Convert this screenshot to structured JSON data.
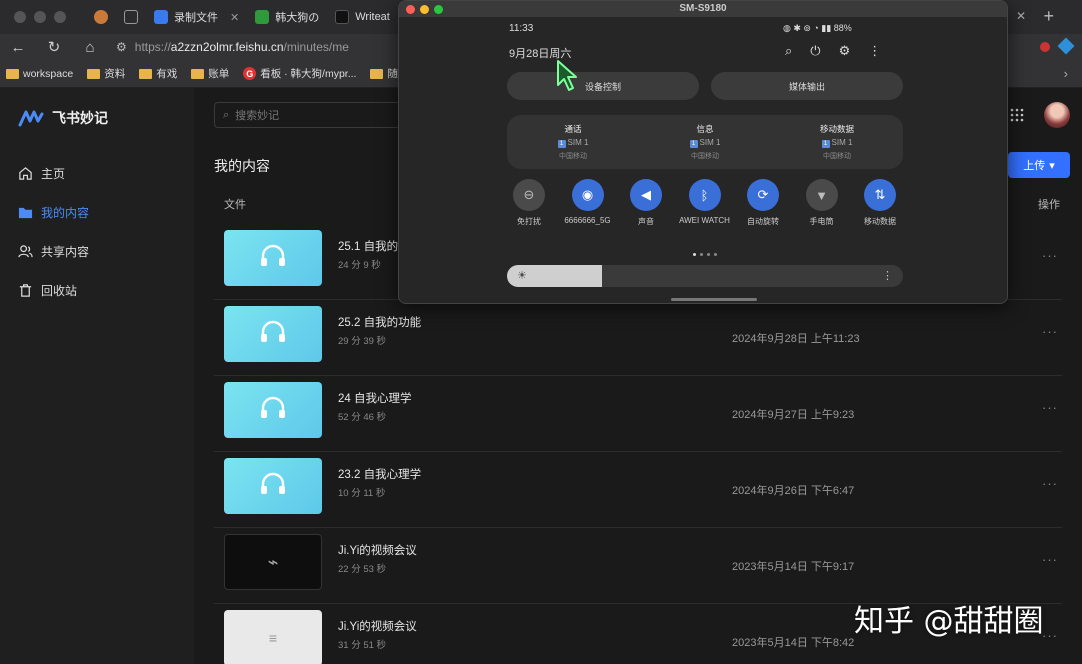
{
  "browser": {
    "tabs": [
      {
        "label": "",
        "color": "#c97a3a"
      },
      {
        "label": "",
        "color": "#555"
      },
      {
        "label": "录制文件",
        "color": "#3a7af0"
      },
      {
        "label": "韩大狗の",
        "color": "#2f9a3a"
      },
      {
        "label": "Writeat",
        "color": "#111"
      }
    ],
    "url_prefix": "https://",
    "url_host": "a2zzn2olmr.feishu.cn",
    "url_path": "/minutes/me",
    "bookmarks": [
      {
        "label": "workspace",
        "type": "folder"
      },
      {
        "label": "资料",
        "type": "folder"
      },
      {
        "label": "有戏",
        "type": "folder"
      },
      {
        "label": "账单",
        "type": "folder"
      },
      {
        "label": "看板 · 韩大狗/mypr...",
        "type": "g"
      },
      {
        "label": "随身",
        "type": "folder"
      }
    ]
  },
  "app": {
    "name": "飞书妙记",
    "nav": [
      {
        "label": "主页",
        "icon": "home-icon",
        "active": false
      },
      {
        "label": "我的内容",
        "icon": "folder-icon",
        "active": true
      },
      {
        "label": "共享内容",
        "icon": "users-icon",
        "active": false
      },
      {
        "label": "回收站",
        "icon": "trash-icon",
        "active": false
      }
    ],
    "search_placeholder": "搜索妙记",
    "page_title": "我的内容",
    "upload_label": "上传",
    "col_file": "文件",
    "col_ops": "操作",
    "rows": [
      {
        "title": "25.1 自我的",
        "duration": "24 分 9 秒",
        "date": "",
        "thumb": "audio"
      },
      {
        "title": "25.2 自我的功能",
        "duration": "29 分 39 秒",
        "date": "2024年9月28日 上午11:23",
        "thumb": "audio"
      },
      {
        "title": "24 自我心理学",
        "duration": "52 分 46 秒",
        "date": "2024年9月27日 上午9:23",
        "thumb": "audio"
      },
      {
        "title": "23.2 自我心理学",
        "duration": "10 分 11 秒",
        "date": "2024年9月26日 下午6:47",
        "thumb": "audio"
      },
      {
        "title": "Ji.Yi的视频会议",
        "duration": "22 分 53 秒",
        "date": "2023年5月14日 下午9:17",
        "thumb": "video"
      },
      {
        "title": "Ji.Yi的视频会议",
        "duration": "31 分 51 秒",
        "date": "2023年5月14日 下午8:42",
        "thumb": "doc"
      }
    ]
  },
  "mirror": {
    "title": "SM-S9180",
    "time": "11:33",
    "battery": "88%",
    "date": "9月28日周六",
    "device_control": "设备控制",
    "media_output": "媒体输出",
    "sims": [
      {
        "title": "通话",
        "sim": "SIM 1",
        "carrier": "中国移动"
      },
      {
        "title": "信息",
        "sim": "SIM 1",
        "carrier": "中国移动"
      },
      {
        "title": "移动数据",
        "sim": "SIM 1",
        "carrier": "中国移动"
      }
    ],
    "quick": [
      {
        "label": "免打扰",
        "glyph": "⊖",
        "on": false
      },
      {
        "label": "6666666_5G",
        "glyph": "◉",
        "on": true
      },
      {
        "label": "声音",
        "glyph": "◀",
        "on": true
      },
      {
        "label": "AWEI WATCH",
        "glyph": "ᛒ",
        "on": true
      },
      {
        "label": "自动旋转",
        "glyph": "⟳",
        "on": true
      },
      {
        "label": "手电筒",
        "glyph": "▼",
        "on": false
      },
      {
        "label": "移动数据",
        "glyph": "⇅",
        "on": true
      }
    ],
    "brightness": 0.24
  },
  "watermark": "知乎 @甜甜圈"
}
